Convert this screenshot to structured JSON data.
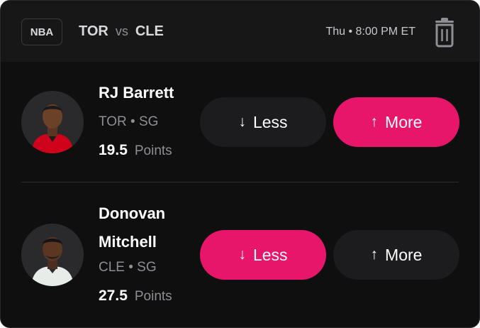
{
  "header": {
    "league": "NBA",
    "team_away": "TOR",
    "vs": "vs",
    "team_home": "CLE",
    "game_time": "Thu • 8:00 PM ET",
    "trash_icon": "trash-icon"
  },
  "players": [
    {
      "name": "RJ Barrett",
      "meta": "TOR • SG",
      "line": "19.5",
      "stat": "Points",
      "less_label": "Less",
      "more_label": "More",
      "selected": "more",
      "jersey_color": "#d0021b"
    },
    {
      "name": "Donovan Mitchell",
      "name_line1": "Donovan",
      "name_line2": "Mitchell",
      "meta": "CLE • SG",
      "line": "27.5",
      "stat": "Points",
      "less_label": "Less",
      "more_label": "More",
      "selected": "less",
      "jersey_color": "#e8ece8"
    }
  ],
  "colors": {
    "accent": "#e8166b",
    "background": "#0f0f10",
    "button_inactive": "#1c1c1e"
  }
}
